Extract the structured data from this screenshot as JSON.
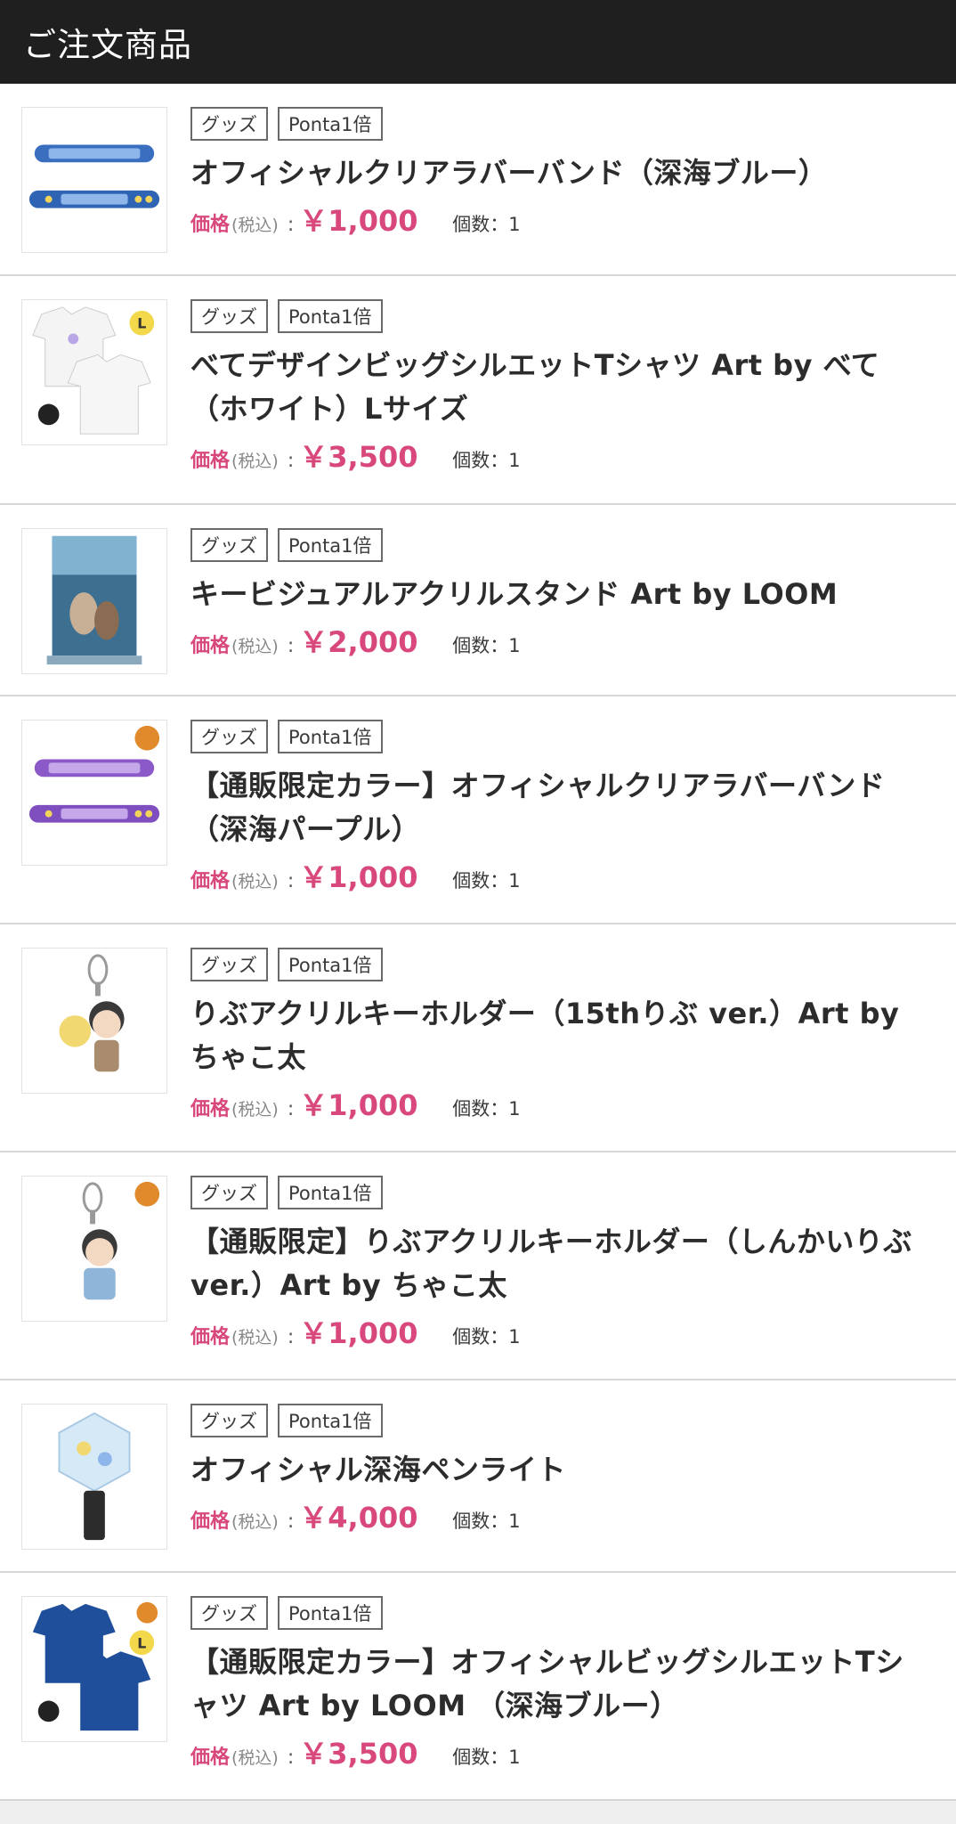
{
  "header": {
    "title": "ご注文商品"
  },
  "items": [
    {
      "tags": [
        "グッズ",
        "Ponta1倍"
      ],
      "name": "オフィシャルクリアラバーバンド（深海ブルー）",
      "price_label": "価格",
      "tax_note": "(税込)",
      "price_colon": ":",
      "price": "￥1,000",
      "qty": "個数：1",
      "thumb": "blue-rubber-band"
    },
    {
      "tags": [
        "グッズ",
        "Ponta1倍"
      ],
      "name": "べてデザインビッグシルエットTシャツ Art by べて（ホワイト）Lサイズ",
      "price_label": "価格",
      "tax_note": "(税込)",
      "price_colon": ":",
      "price": "￥3,500",
      "qty": "個数：1",
      "thumb": "white-tshirt",
      "badge": "L"
    },
    {
      "tags": [
        "グッズ",
        "Ponta1倍"
      ],
      "name": "キービジュアルアクリルスタンド Art by LOOM",
      "price_label": "価格",
      "tax_note": "(税込)",
      "price_colon": ":",
      "price": "￥2,000",
      "qty": "個数：1",
      "thumb": "acrylic-stand"
    },
    {
      "tags": [
        "グッズ",
        "Ponta1倍"
      ],
      "name": "【通販限定カラー】オフィシャルクリアラバーバンド（深海パープル）",
      "price_label": "価格",
      "tax_note": "(税込)",
      "price_colon": ":",
      "price": "￥1,000",
      "qty": "個数：1",
      "thumb": "purple-rubber-band"
    },
    {
      "tags": [
        "グッズ",
        "Ponta1倍"
      ],
      "name": "りぶアクリルキーホルダー（15thりぶ ver.）Art by ちゃこ太",
      "price_label": "価格",
      "tax_note": "(税込)",
      "price_colon": ":",
      "price": "￥1,000",
      "qty": "個数：1",
      "thumb": "keyholder"
    },
    {
      "tags": [
        "グッズ",
        "Ponta1倍"
      ],
      "name": "【通販限定】りぶアクリルキーホルダー（しんかいりぶ ver.）Art by ちゃこ太",
      "price_label": "価格",
      "tax_note": "(税込)",
      "price_colon": ":",
      "price": "￥1,000",
      "qty": "個数：1",
      "thumb": "keyholder-limited"
    },
    {
      "tags": [
        "グッズ",
        "Ponta1倍"
      ],
      "name": "オフィシャル深海ペンライト",
      "price_label": "価格",
      "tax_note": "(税込)",
      "price_colon": ":",
      "price": "￥4,000",
      "qty": "個数：1",
      "thumb": "penlight"
    },
    {
      "tags": [
        "グッズ",
        "Ponta1倍"
      ],
      "name": "【通販限定カラー】オフィシャルビッグシルエットTシャツ Art by LOOM （深海ブルー）",
      "price_label": "価格",
      "tax_note": "(税込)",
      "price_colon": ":",
      "price": "￥3,500",
      "qty": "個数：1",
      "thumb": "blue-tshirt",
      "badge": "L"
    }
  ],
  "colors": {
    "header_bg": "#1f1f1f",
    "price_accent": "#d8487c",
    "divider": "#d6d6d6"
  }
}
